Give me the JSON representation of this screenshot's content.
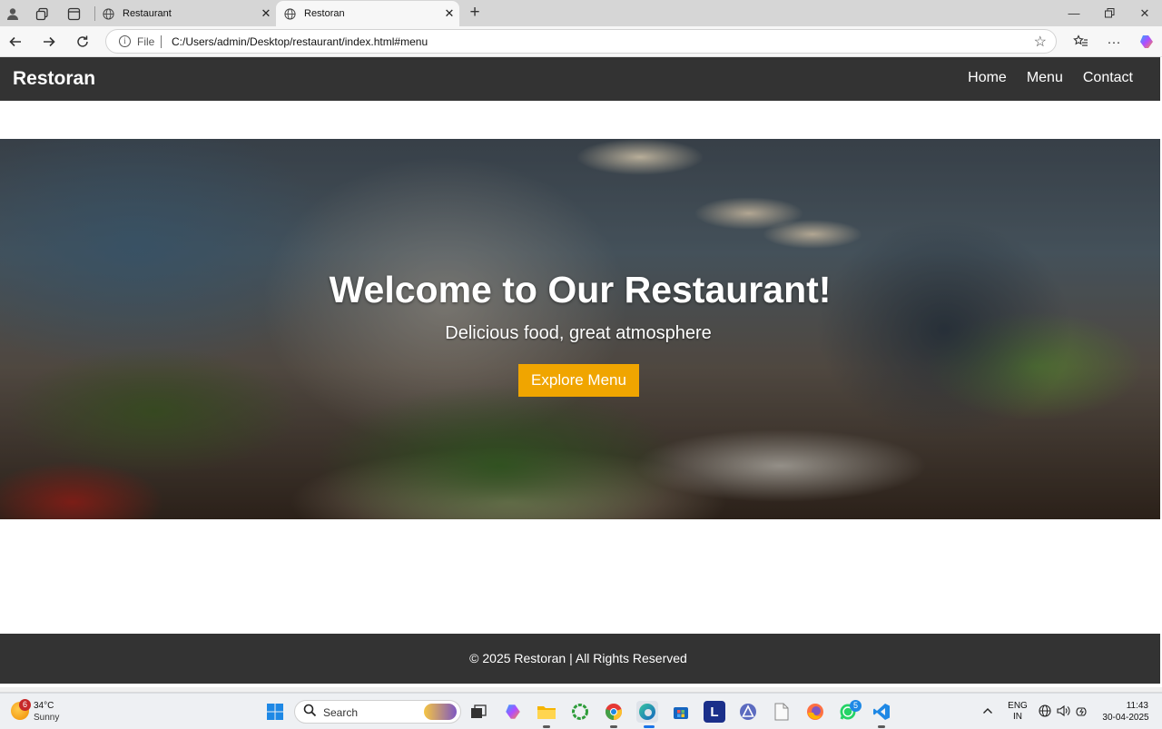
{
  "browser": {
    "tabs": [
      {
        "title": "Restaurant",
        "active": false
      },
      {
        "title": "Restoran",
        "active": true
      }
    ],
    "address": {
      "scheme_label": "File",
      "url": "C:/Users/admin/Desktop/restaurant/index.html#menu"
    },
    "icons": {
      "profile": "profile-icon",
      "workspaces": "workspaces-icon",
      "tab_actions": "tab-actions-icon",
      "back": "back-arrow-icon",
      "forward": "forward-arrow-icon",
      "refresh": "refresh-icon",
      "favorite": "star-icon",
      "favorites": "favorites-icon",
      "more": "more-icon",
      "copilot": "copilot-icon"
    }
  },
  "site": {
    "brand": "Restoran",
    "nav": [
      "Home",
      "Menu",
      "Contact"
    ],
    "hero": {
      "title": "Welcome to Our Restaurant!",
      "subtitle": "Delicious food, great atmosphere",
      "cta": "Explore Menu"
    },
    "footer": "© 2025 Restoran | All Rights Reserved",
    "colors": {
      "header": "#333333",
      "footer": "#333333",
      "accent": "#f0a500"
    }
  },
  "taskbar": {
    "weather": {
      "badge": "6",
      "temp": "34°C",
      "condition": "Sunny"
    },
    "search_label": "Search",
    "whatsapp_badge": "5",
    "apps": [
      "windows-start-icon",
      "file-explorer-icon",
      "copilot-icon",
      "folder-icon",
      "green-ring-icon",
      "chrome-icon",
      "edge-icon",
      "store-icon",
      "l-app-icon",
      "triangle-app-icon",
      "document-icon",
      "firefox-icon",
      "whatsapp-icon",
      "vscode-icon"
    ],
    "language": {
      "line1": "ENG",
      "line2": "IN"
    },
    "clock": {
      "time": "11:43",
      "date": "30-04-2025"
    }
  }
}
